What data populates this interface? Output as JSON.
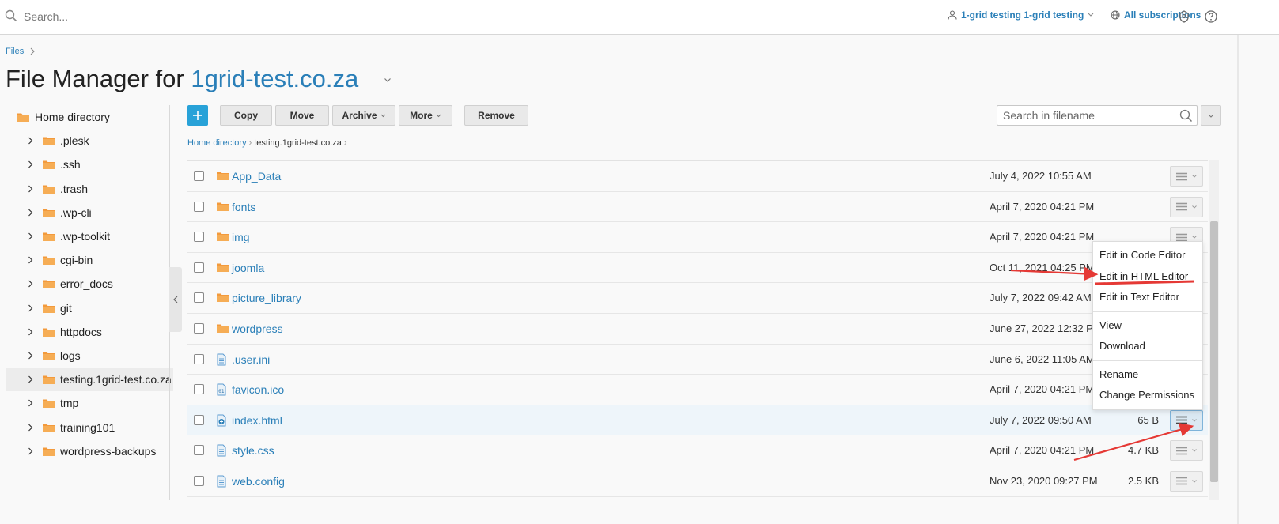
{
  "topbar": {
    "search_placeholder": "Search...",
    "user_label": "1-grid testing 1-grid testing",
    "subscriptions_label": "All subscriptions"
  },
  "breadcrumb": {
    "files": "Files"
  },
  "title": {
    "prefix": "File Manager for ",
    "domain": "1grid-test.co.za"
  },
  "tree": {
    "root": "Home directory",
    "items": [
      ".plesk",
      ".ssh",
      ".trash",
      ".wp-cli",
      ".wp-toolkit",
      "cgi-bin",
      "error_docs",
      "git",
      "httpdocs",
      "logs",
      "testing.1grid-test.co.za",
      "tmp",
      "training101",
      "wordpress-backups"
    ]
  },
  "toolbar": {
    "copy": "Copy",
    "move": "Move",
    "archive": "Archive",
    "more": "More",
    "remove": "Remove",
    "search_placeholder": "Search in filename"
  },
  "path": {
    "home": "Home directory",
    "current": "testing.1grid-test.co.za"
  },
  "files": [
    {
      "name": "App_Data",
      "date": "July 4, 2022 10:55 AM",
      "size": "",
      "type": "folder"
    },
    {
      "name": "fonts",
      "date": "April 7, 2020 04:21 PM",
      "size": "",
      "type": "folder"
    },
    {
      "name": "img",
      "date": "April 7, 2020 04:21 PM",
      "size": "",
      "type": "folder"
    },
    {
      "name": "joomla",
      "date": "Oct 11, 2021 04:25 PM",
      "size": "",
      "type": "folder"
    },
    {
      "name": "picture_library",
      "date": "July 7, 2022 09:42 AM",
      "size": "",
      "type": "folder"
    },
    {
      "name": "wordpress",
      "date": "June 27, 2022 12:32 PM",
      "size": "",
      "type": "folder"
    },
    {
      "name": ".user.ini",
      "date": "June 6, 2022 11:05 AM",
      "size": "",
      "type": "file"
    },
    {
      "name": "favicon.ico",
      "date": "April 7, 2020 04:21 PM",
      "size": "",
      "type": "binary"
    },
    {
      "name": "index.html",
      "date": "July 7, 2022 09:50 AM",
      "size": "65 B",
      "type": "html"
    },
    {
      "name": "style.css",
      "date": "April 7, 2020 04:21 PM",
      "size": "4.7 KB",
      "type": "file"
    },
    {
      "name": "web.config",
      "date": "Nov 23, 2020 09:27 PM",
      "size": "2.5 KB",
      "type": "file"
    }
  ],
  "context_menu": {
    "edit_code": "Edit in Code Editor",
    "edit_html": "Edit in HTML Editor",
    "edit_text": "Edit in Text Editor",
    "view": "View",
    "download": "Download",
    "rename": "Rename",
    "permissions": "Change Permissions"
  },
  "colors": {
    "link": "#2a7fb8",
    "folder": "#f39a3c",
    "add_button": "#28a2d8",
    "annotation_arrow": "#e53935"
  }
}
